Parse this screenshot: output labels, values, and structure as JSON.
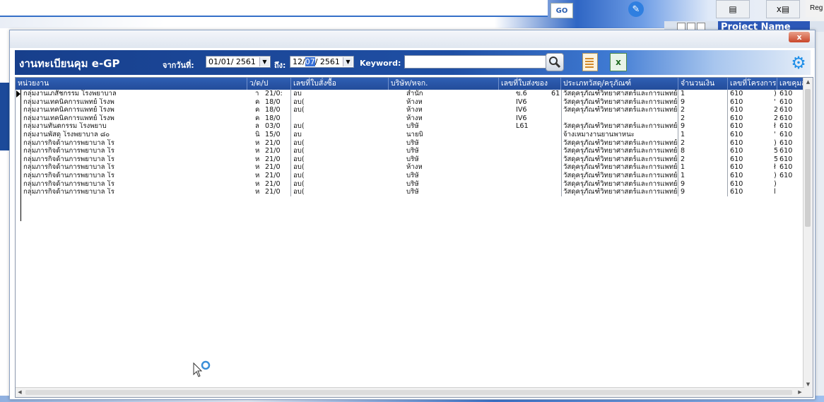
{
  "background": {
    "go_label": "GO",
    "reg_label": "Reg",
    "project_name": "Project Name",
    "edit_icon": "edit-icon",
    "export_icon": "export-icon",
    "excel_icon": "excel-icon"
  },
  "dialog": {
    "close_label": "x",
    "toolbar": {
      "title": "งานทะเบียนคุม e-GP",
      "from_label": "จากวันที่:",
      "from_date": "01/01/ 2561",
      "to_label": "ถึง:",
      "to_date_day": "12/",
      "to_date_month": "07",
      "to_date_year": "/ 2561",
      "keyword_label": "Keyword:",
      "keyword_value": ""
    }
  },
  "grid": {
    "columns": [
      "หน่วยงาน",
      "ว/ด/ป",
      "เลขที่ใบสั่งซื้อ",
      "บริษัท/หจก.",
      "เลขที่ใบส่งของ",
      "ประเภทวัสดุ/ครุภัณฑ์",
      "จำนวนเงิน",
      "เลขที่โครงการ",
      "เลขคุมสั"
    ],
    "rows": [
      {
        "unit": "กลุ่มงานเภสัชกรรม โรงพยาบาล",
        "unit_tail": "า",
        "date": "21/0:",
        "po": "อบ",
        "company": "สำนัก",
        "invoice": "ข.6",
        "invoice_tail": "61",
        "category": "วัสดุครุภัณฑ์วิทยาศาสตร์และการแพทย์",
        "amount": "1",
        "project": "610",
        "control_pre": ")",
        "control": "610"
      },
      {
        "unit": "กลุ่มงานเทคนิคการแพทย์ โรงพ",
        "unit_tail": "ค",
        "date": "18/0",
        "po": "อบ(",
        "company": "ห้างห",
        "invoice": "IV6",
        "invoice_tail": "",
        "category": "วัสดุครุภัณฑ์วิทยาศาสตร์และการแพทย์",
        "amount": "9",
        "project": "610",
        "control_pre": "'",
        "control": "610"
      },
      {
        "unit": "กลุ่มงานเทคนิคการแพทย์ โรงพ",
        "unit_tail": "ค",
        "date": "18/0",
        "po": "อบ(",
        "company": "ห้างห",
        "invoice": "IV6",
        "invoice_tail": "",
        "category": "วัสดุครุภัณฑ์วิทยาศาสตร์และการแพทย์",
        "amount": "2",
        "project": "610",
        "control_pre": "2",
        "control": "610"
      },
      {
        "unit": "กลุ่มงานเทคนิคการแพทย์ โรงพ",
        "unit_tail": "ค",
        "date": "18/0",
        "po": "",
        "company": "ห้างห",
        "invoice": "IV6",
        "invoice_tail": "",
        "category": "",
        "amount": "2",
        "project": "610",
        "control_pre": "2",
        "control": "610"
      },
      {
        "unit": "กลุ่มงานทันตกรรม โรงพยาบ",
        "unit_tail": "ล",
        "date": "03/0",
        "po": "อบ(",
        "company": "บริษั",
        "invoice": "L61",
        "invoice_tail": "",
        "category": "วัสดุครุภัณฑ์วิทยาศาสตร์และการแพทย์",
        "amount": "9",
        "project": "610",
        "control_pre": "ł",
        "control": "610"
      },
      {
        "unit": "กลุ่มงานพัสดุ โรงพยาบาล ๘๐",
        "unit_tail": "นิ",
        "date": "15/0",
        "po": "อบ",
        "company": "นายนิ",
        "invoice": "",
        "invoice_tail": "",
        "category": "จ้างเหมางานยานพาหนะ",
        "amount": "1",
        "project": "610",
        "control_pre": "'",
        "control": "610"
      },
      {
        "unit": "กลุ่มภารกิจด้านการพยาบาล โร",
        "unit_tail": "ห",
        "date": "21/0",
        "po": "อบ(",
        "company": "บริษั",
        "invoice": "",
        "invoice_tail": "",
        "category": "วัสดุครุภัณฑ์วิทยาศาสตร์และการแพทย์",
        "amount": "2",
        "project": "610",
        "control_pre": ")",
        "control": "610"
      },
      {
        "unit": "กลุ่มภารกิจด้านการพยาบาล โร",
        "unit_tail": "ห",
        "date": "21/0",
        "po": "อบ(",
        "company": "บริษั",
        "invoice": "",
        "invoice_tail": "",
        "category": "วัสดุครุภัณฑ์วิทยาศาสตร์และการแพทย์",
        "amount": "8",
        "project": "610",
        "control_pre": "5",
        "control": "610"
      },
      {
        "unit": "กลุ่มภารกิจด้านการพยาบาล โร",
        "unit_tail": "ห",
        "date": "21/0",
        "po": "อบ(",
        "company": "บริษั",
        "invoice": "",
        "invoice_tail": "",
        "category": "วัสดุครุภัณฑ์วิทยาศาสตร์และการแพทย์",
        "amount": "2",
        "project": "610",
        "control_pre": "5",
        "control": "610"
      },
      {
        "unit": "กลุ่มภารกิจด้านการพยาบาล โร",
        "unit_tail": "ห",
        "date": "21/0",
        "po": "อบ(",
        "company": "ห้างห",
        "invoice": "",
        "invoice_tail": "",
        "category": "วัสดุครุภัณฑ์วิทยาศาสตร์และการแพทย์",
        "amount": "1",
        "project": "610",
        "control_pre": "ł",
        "control": "610"
      },
      {
        "unit": "กลุ่มภารกิจด้านการพยาบาล โร",
        "unit_tail": "ห",
        "date": "21/0",
        "po": "อบ(",
        "company": "บริษั",
        "invoice": "",
        "invoice_tail": "",
        "category": "วัสดุครุภัณฑ์วิทยาศาสตร์และการแพทย์",
        "amount": "1",
        "project": "610",
        "control_pre": ")",
        "control": "610"
      },
      {
        "unit": "กลุ่มภารกิจด้านการพยาบาล โร",
        "unit_tail": "ห",
        "date": "21/0",
        "po": "อบ(",
        "company": "บริษั",
        "invoice": "",
        "invoice_tail": "",
        "category": "วัสดุครุภัณฑ์วิทยาศาสตร์และการแพทย์",
        "amount": "9",
        "project": "610",
        "control_pre": ")",
        "control": ""
      },
      {
        "unit": "กลุ่มภารกิจด้านการพยาบาล โร",
        "unit_tail": "ห",
        "date": "21/0",
        "po": "อบ(",
        "company": "บริษั",
        "invoice": "",
        "invoice_tail": "",
        "category": "วัสดุครุภัณฑ์วิทยาศาสตร์และการแพทย์",
        "amount": "9",
        "project": "610",
        "control_pre": "l",
        "control": ""
      }
    ]
  }
}
